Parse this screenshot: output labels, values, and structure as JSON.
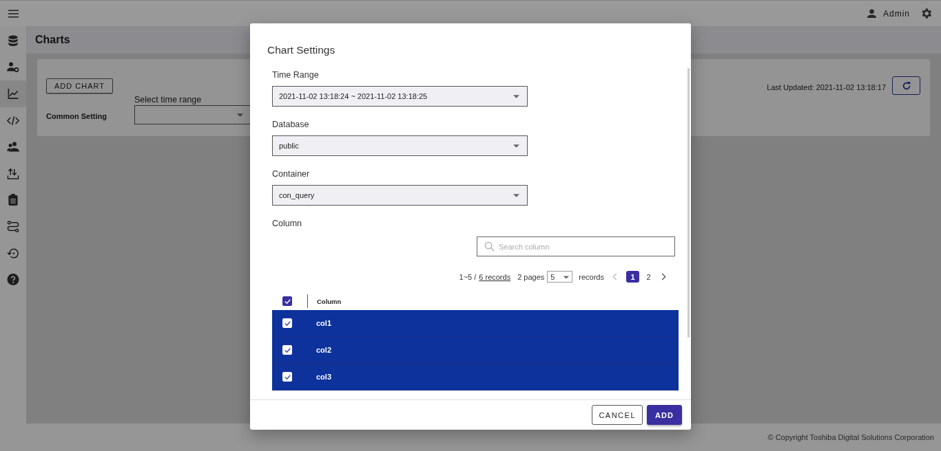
{
  "header": {
    "user": "Admin"
  },
  "sidebar": {
    "items": [
      {
        "kind": "database",
        "selected": false
      },
      {
        "kind": "user-gear",
        "selected": false
      },
      {
        "kind": "chart",
        "selected": true
      },
      {
        "kind": "code",
        "selected": false
      },
      {
        "kind": "users",
        "selected": false
      },
      {
        "kind": "transfer",
        "selected": false
      },
      {
        "kind": "clipboard",
        "selected": false
      },
      {
        "kind": "route",
        "selected": false
      },
      {
        "kind": "restore",
        "selected": false
      },
      {
        "kind": "help",
        "selected": false
      }
    ]
  },
  "page": {
    "title": "Charts",
    "add_chart_button": "ADD CHART",
    "common_setting_label": "Common Setting",
    "time_range_label": "Select time range",
    "last_updated": "Last Updated: 2021-11-02 13:18:17"
  },
  "footer": {
    "copyright": "© Copyright Toshiba Digital Solutions Corporation"
  },
  "dialog": {
    "title": "Chart Settings",
    "fields": [
      {
        "label": "Time Range",
        "value": "2021-11-02 13:18:24 ~ 2021-11-02 13:18:25"
      },
      {
        "label": "Database",
        "value": "public"
      },
      {
        "label": "Container",
        "value": "con_query"
      }
    ],
    "column_section": {
      "label": "Column",
      "search_placeholder": "Search column",
      "range": "1~5 /",
      "records_link": "6 records",
      "pages": "2 pages",
      "page_size": "5",
      "records_label": "records",
      "pagination": [
        {
          "label": "1",
          "selected": true
        },
        {
          "label": "2",
          "selected": false
        }
      ],
      "header_checked": true,
      "header": "Column",
      "rows": [
        {
          "name": "col1",
          "selected": true
        },
        {
          "name": "col2",
          "selected": true
        },
        {
          "name": "col3",
          "selected": true
        }
      ]
    },
    "buttons": {
      "cancel": "CANCEL",
      "add": "ADD"
    }
  }
}
